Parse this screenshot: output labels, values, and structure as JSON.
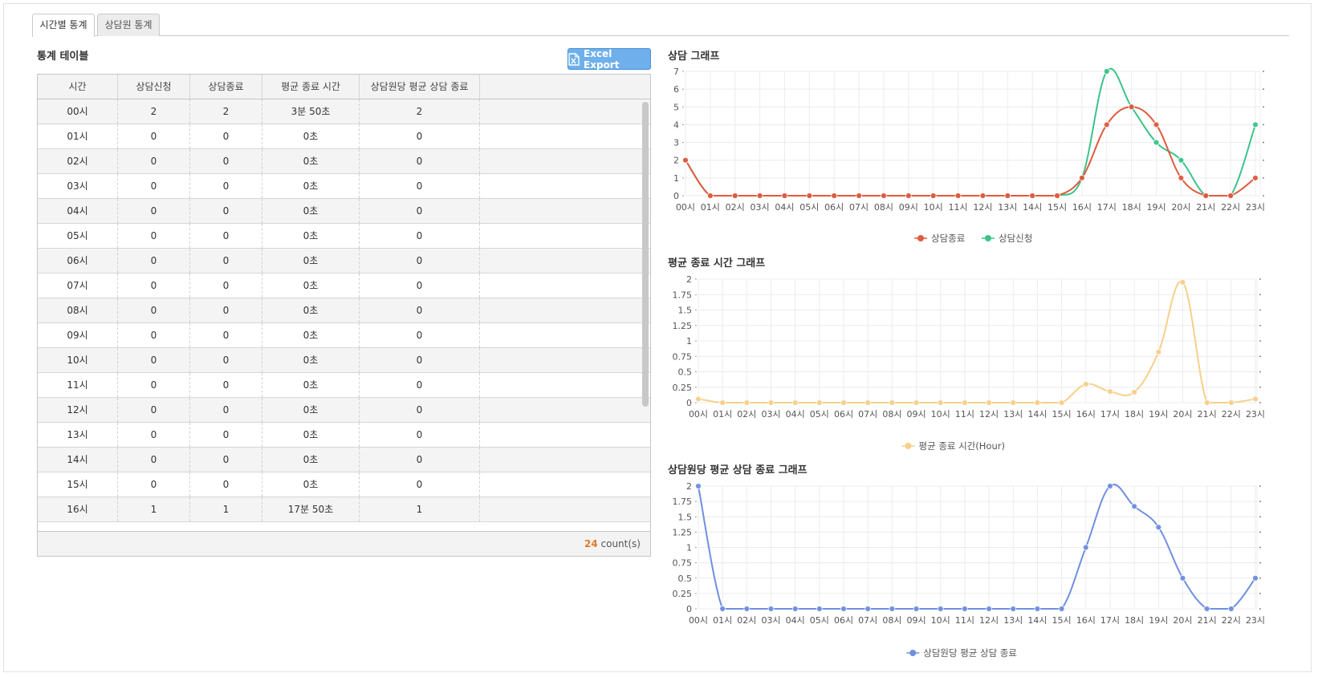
{
  "tabs": [
    {
      "label": "시간별 통계",
      "active": true
    },
    {
      "label": "상담원 통계",
      "active": false
    }
  ],
  "table_section": {
    "title": "통계 테이블",
    "excel_button": "Excel Export",
    "columns": [
      "시간",
      "상담신청",
      "상담종료",
      "평균 종료 시간",
      "상담원당 평균 상담 종료"
    ],
    "rows": [
      [
        "00시",
        "2",
        "2",
        "3분 50초",
        "2"
      ],
      [
        "01시",
        "0",
        "0",
        "0초",
        "0"
      ],
      [
        "02시",
        "0",
        "0",
        "0초",
        "0"
      ],
      [
        "03시",
        "0",
        "0",
        "0초",
        "0"
      ],
      [
        "04시",
        "0",
        "0",
        "0초",
        "0"
      ],
      [
        "05시",
        "0",
        "0",
        "0초",
        "0"
      ],
      [
        "06시",
        "0",
        "0",
        "0초",
        "0"
      ],
      [
        "07시",
        "0",
        "0",
        "0초",
        "0"
      ],
      [
        "08시",
        "0",
        "0",
        "0초",
        "0"
      ],
      [
        "09시",
        "0",
        "0",
        "0초",
        "0"
      ],
      [
        "10시",
        "0",
        "0",
        "0초",
        "0"
      ],
      [
        "11시",
        "0",
        "0",
        "0초",
        "0"
      ],
      [
        "12시",
        "0",
        "0",
        "0초",
        "0"
      ],
      [
        "13시",
        "0",
        "0",
        "0초",
        "0"
      ],
      [
        "14시",
        "0",
        "0",
        "0초",
        "0"
      ],
      [
        "15시",
        "0",
        "0",
        "0초",
        "0"
      ],
      [
        "16시",
        "1",
        "1",
        "17분 50초",
        "1"
      ]
    ],
    "count": "24",
    "count_suffix": "count(s)"
  },
  "chart_data": [
    {
      "type": "line",
      "title": "상담 그래프",
      "x": [
        "00시",
        "01시",
        "02시",
        "03시",
        "04시",
        "05시",
        "06시",
        "07시",
        "08시",
        "09시",
        "10시",
        "11시",
        "12시",
        "13시",
        "14시",
        "15시",
        "16시",
        "17시",
        "18시",
        "19시",
        "20시",
        "21시",
        "22시",
        "23시"
      ],
      "ylim": [
        0,
        7
      ],
      "yticks": [
        "0",
        "1",
        "2",
        "3",
        "4",
        "5",
        "6",
        "7"
      ],
      "grid": true,
      "legend_position": "bottom",
      "series": [
        {
          "name": "상담종료",
          "color": "#e05a3f",
          "values": [
            2,
            0,
            0,
            0,
            0,
            0,
            0,
            0,
            0,
            0,
            0,
            0,
            0,
            0,
            0,
            0,
            1,
            4,
            5,
            4,
            1,
            0,
            0,
            1
          ]
        },
        {
          "name": "상담신청",
          "color": "#3cc38a",
          "values": [
            2,
            0,
            0,
            0,
            0,
            0,
            0,
            0,
            0,
            0,
            0,
            0,
            0,
            0,
            0,
            0,
            1,
            7,
            5,
            3,
            2,
            0,
            0,
            4
          ]
        }
      ]
    },
    {
      "type": "line",
      "title": "평균 종료 시간 그래프",
      "x": [
        "00시",
        "01시",
        "02시",
        "03시",
        "04시",
        "05시",
        "06시",
        "07시",
        "08시",
        "09시",
        "10시",
        "11시",
        "12시",
        "13시",
        "14시",
        "15시",
        "16시",
        "17시",
        "18시",
        "19시",
        "20시",
        "21시",
        "22시",
        "23시"
      ],
      "ylim": [
        0,
        2
      ],
      "yticks": [
        "0",
        "0.25",
        "0.5",
        "0.75",
        "1",
        "1.25",
        "1.5",
        "1.75",
        "2"
      ],
      "grid": true,
      "legend_position": "bottom",
      "series": [
        {
          "name": "평균 종료 시간(Hour)",
          "color": "#f7cf8a",
          "values": [
            0.06,
            0,
            0,
            0,
            0,
            0,
            0,
            0,
            0,
            0,
            0,
            0,
            0,
            0,
            0,
            0,
            0.3,
            0.18,
            0.17,
            0.82,
            1.95,
            0,
            0,
            0.06
          ]
        }
      ]
    },
    {
      "type": "line",
      "title": "상담원당 평균 상담 종료 그래프",
      "x": [
        "00시",
        "01시",
        "02시",
        "03시",
        "04시",
        "05시",
        "06시",
        "07시",
        "08시",
        "09시",
        "10시",
        "11시",
        "12시",
        "13시",
        "14시",
        "15시",
        "16시",
        "17시",
        "18시",
        "19시",
        "20시",
        "21시",
        "22시",
        "23시"
      ],
      "ylim": [
        0,
        2
      ],
      "yticks": [
        "0",
        "0.25",
        "0.5",
        "0.75",
        "1",
        "1.25",
        "1.5",
        "1.75",
        "2"
      ],
      "grid": true,
      "legend_position": "bottom",
      "series": [
        {
          "name": "상담원당 평균 상담 종료",
          "color": "#6f8fe0",
          "values": [
            2,
            0,
            0,
            0,
            0,
            0,
            0,
            0,
            0,
            0,
            0,
            0,
            0,
            0,
            0,
            0,
            1,
            2,
            1.67,
            1.33,
            0.5,
            0,
            0,
            0.5
          ]
        }
      ]
    }
  ]
}
